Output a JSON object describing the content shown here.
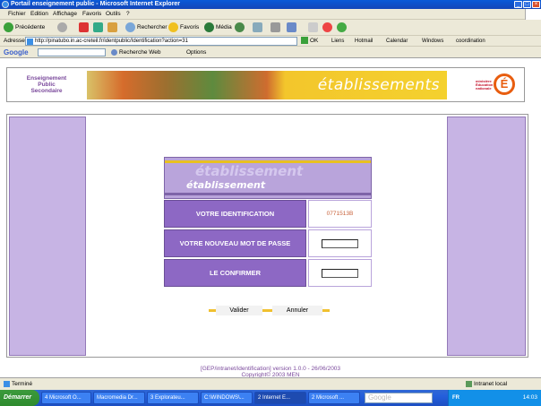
{
  "window": {
    "title": "Portail enseignement public - Microsoft Internet Explorer"
  },
  "menu": [
    "Fichier",
    "Edition",
    "Affichage",
    "Favoris",
    "Outils",
    "?"
  ],
  "toolbar": {
    "back": "Précédente",
    "search": "Rechercher",
    "favorites": "Favoris",
    "media": "Média"
  },
  "address": {
    "label": "Adresse",
    "url": "http://pinatubo.in.ac-creteil.fr/identpublic/Identification?action=31",
    "go": "OK",
    "links_label": "Liens",
    "links": [
      "Hotmail",
      "Calendar",
      "Windows",
      "coordination"
    ]
  },
  "google_bar": {
    "logo": "Google",
    "search_web": "Recherche Web",
    "options": "Options"
  },
  "header": {
    "left_text": [
      "Enseignement",
      "Public",
      "Secondaire"
    ],
    "banner_text": "établissements",
    "logo_lines": [
      "ministère",
      "Éducation",
      "nationale"
    ],
    "logo_letter": "É"
  },
  "form": {
    "title_big": "établissement",
    "title_small": "établissement",
    "id_label": "VOTRE IDENTIFICATION",
    "id_value": "0771513B",
    "newpw_label": "VOTRE NOUVEAU MOT DE PASSE",
    "confirm_label": "LE CONFIRMER",
    "submit": "Valider",
    "cancel": "Annuler"
  },
  "footer": {
    "line1": "[GEP/intranet/identification] version 1.0.0 - 26/06/2003",
    "line2": "Copyright© 2003 MEN"
  },
  "status": {
    "left": "Terminé",
    "right": "Intranet local"
  },
  "taskbar": {
    "start": "Démarrer",
    "tasks": [
      "4 Microsoft O...",
      "Macromedia Dr...",
      "3 Explorateu...",
      "C:\\WINDOWS\\...",
      "2 Internet E...",
      "2 Microsoft ..."
    ],
    "google_box": "Google",
    "lang": "FR",
    "clock": "14:03"
  }
}
